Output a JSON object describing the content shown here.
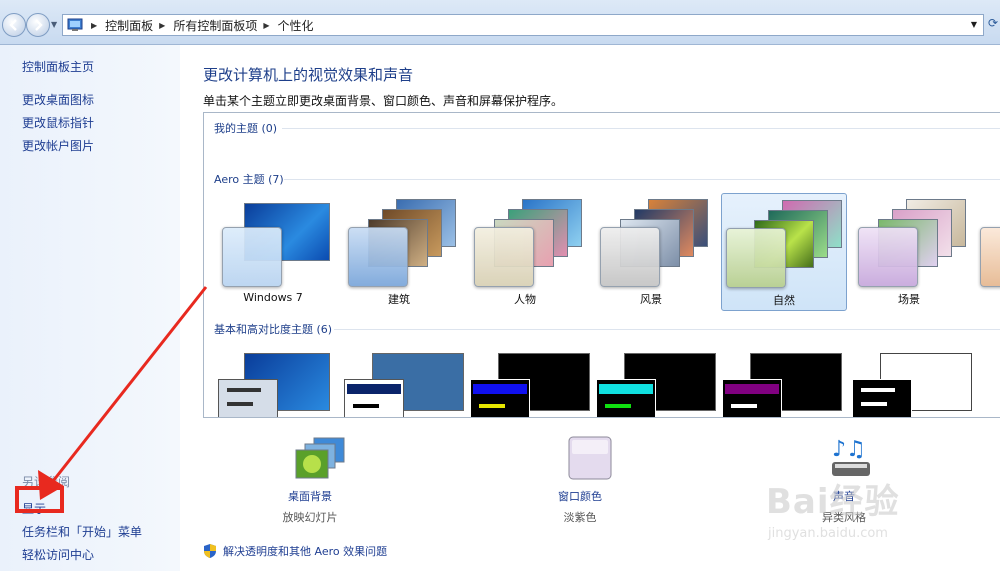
{
  "breadcrumb": {
    "items": [
      "控制面板",
      "所有控制面板项",
      "个性化"
    ]
  },
  "sidebar": {
    "home": "控制面板主页",
    "links": [
      "更改桌面图标",
      "更改鼠标指针",
      "更改帐户图片"
    ],
    "see_also": "另请参阅",
    "bottom_links": [
      "显示",
      "任务栏和「开始」菜单",
      "轻松访问中心"
    ]
  },
  "main": {
    "title": "更改计算机上的视觉效果和声音",
    "description": "单击某个主题立即更改桌面背景、窗口颜色、声音和屏幕保护程序。",
    "groups": {
      "mine": "我的主题 (0)",
      "aero": "Aero 主题 (7)",
      "basic": "基本和高对比度主题 (6)"
    },
    "aero_themes": [
      {
        "label": "Windows 7",
        "selected": false
      },
      {
        "label": "建筑",
        "selected": false
      },
      {
        "label": "人物",
        "selected": false
      },
      {
        "label": "风景",
        "selected": false
      },
      {
        "label": "自然",
        "selected": true
      },
      {
        "label": "场景",
        "selected": false
      }
    ]
  },
  "settings": {
    "background": {
      "label": "桌面背景",
      "value": "放映幻灯片"
    },
    "color": {
      "label": "窗口颜色",
      "value": "淡紫色"
    },
    "sound": {
      "label": "声音",
      "value": "异类风格"
    }
  },
  "troubleshoot": "解决透明度和其他 Aero 效果问题",
  "watermark": {
    "text": "Bai经验",
    "url": "jingyan.baidu.com"
  },
  "colors": {
    "link": "#1f3e92",
    "highlight": "#e8291f",
    "selection": "#cfe4f8"
  }
}
